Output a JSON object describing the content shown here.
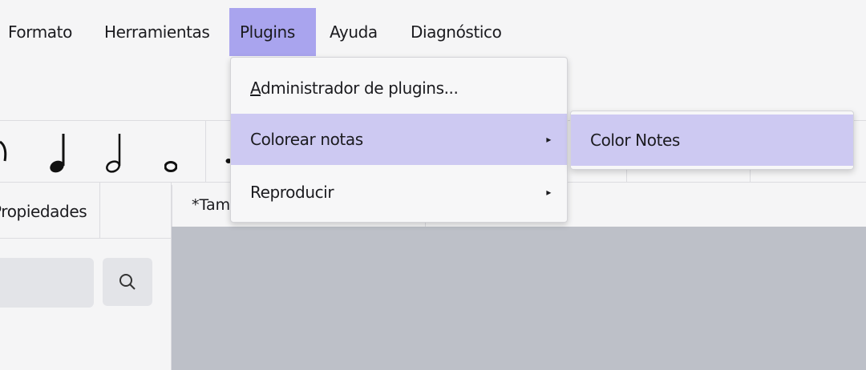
{
  "menubar": {
    "items": [
      {
        "label": "Formato"
      },
      {
        "label": "Herramientas"
      },
      {
        "label": "Plugins"
      },
      {
        "label": "Ayuda"
      },
      {
        "label": "Diagnóstico"
      }
    ],
    "active": "Plugins",
    "active_color": "#a9a4ee"
  },
  "plugins_menu": {
    "items": [
      {
        "label_first": "A",
        "label_rest": "dministrador de plugins...",
        "has_submenu": false
      },
      {
        "label": "Colorear notas",
        "has_submenu": true,
        "highlighted": true
      },
      {
        "label": "Reproducir",
        "has_submenu": true
      }
    ],
    "submenu_arrow": "▸",
    "highlight_color": "#cdc9f2"
  },
  "submenu": {
    "items": [
      {
        "label": "Color Notes",
        "highlighted": true
      }
    ]
  },
  "toolbar": {
    "icons": [
      "document-icon"
    ]
  },
  "notebar": {
    "icons": [
      "eighth-rest-icon",
      "quarter-note-icon",
      "half-note-icon",
      "whole-note-icon",
      "dotted-note-icon"
    ]
  },
  "panel": {
    "tab_label": "Propiedades",
    "search_icon": "search-icon"
  },
  "score": {
    "tab_label": "*Tam"
  }
}
